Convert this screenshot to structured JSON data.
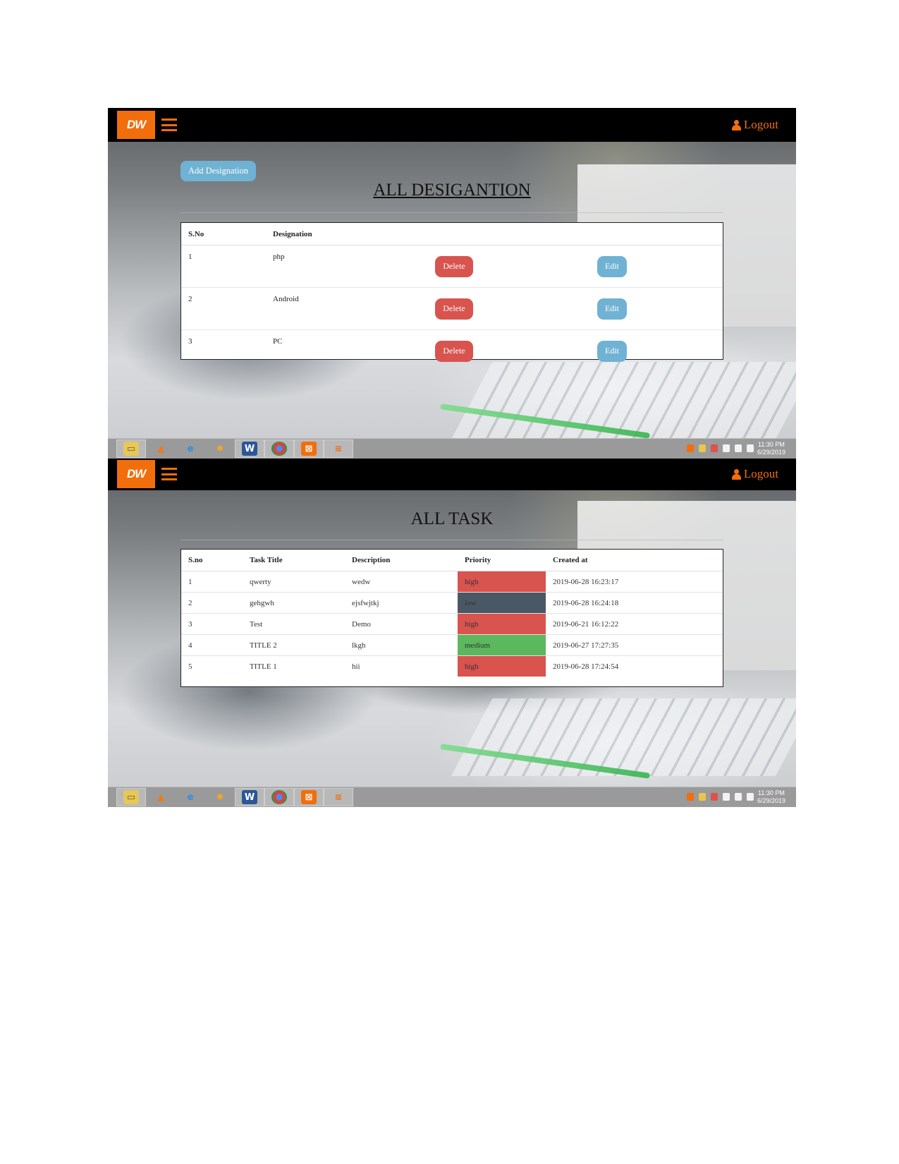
{
  "screenshots": [
    {
      "header": {
        "logo_text": "DW",
        "logout_label": "Logout"
      },
      "add_button_label": "Add Designation",
      "page_title": "ALL DESIGANTION",
      "table": {
        "columns": [
          "S.No",
          "Designation"
        ],
        "rows": [
          {
            "sno": "1",
            "designation": "php",
            "delete_label": "Delete",
            "edit_label": "Edit"
          },
          {
            "sno": "2",
            "designation": "Android",
            "delete_label": "Delete",
            "edit_label": "Edit"
          },
          {
            "sno": "3",
            "designation": "PC",
            "delete_label": "Delete",
            "edit_label": "Edit"
          }
        ]
      },
      "taskbar": {
        "time": "11:30 PM",
        "date": "6/29/2019"
      }
    },
    {
      "header": {
        "logo_text": "DW",
        "logout_label": "Logout"
      },
      "page_title": "ALL TASK",
      "table": {
        "columns": [
          "S.no",
          "Task Title",
          "Description",
          "Priority",
          "Created at"
        ],
        "rows": [
          {
            "sno": "1",
            "title": "qwerty",
            "description": "wedw",
            "priority": "high",
            "created": "2019-06-28 16:23:17"
          },
          {
            "sno": "2",
            "title": "gehgwh",
            "description": "ejsfwjtkj",
            "priority": "low",
            "created": "2019-06-28 16:24:18"
          },
          {
            "sno": "3",
            "title": "Test",
            "description": "Demo",
            "priority": "high",
            "created": "2019-06-21 16:12:22"
          },
          {
            "sno": "4",
            "title": "TITLE 2",
            "description": "lkgh",
            "priority": "medium",
            "created": "2019-06-27 17:27:35"
          },
          {
            "sno": "5",
            "title": "TITLE 1",
            "description": "hii",
            "priority": "high",
            "created": "2019-06-28 17:24:54"
          }
        ]
      },
      "taskbar": {
        "time": "11:30 PM",
        "date": "6/29/2019"
      }
    }
  ],
  "colors": {
    "brand_orange": "#f26e0c",
    "topbar": "#000000",
    "delete_red": "#d9534f",
    "edit_blue": "#6fb2d3",
    "priority_high": "#d9534f",
    "priority_low": "#4a5865",
    "priority_medium": "#5cb85c"
  },
  "taskbar_icons": [
    "file-explorer-icon",
    "vlc-icon",
    "internet-explorer-icon",
    "settings-app-icon",
    "word-icon",
    "chrome-icon",
    "xampp-icon",
    "sublime-icon"
  ]
}
